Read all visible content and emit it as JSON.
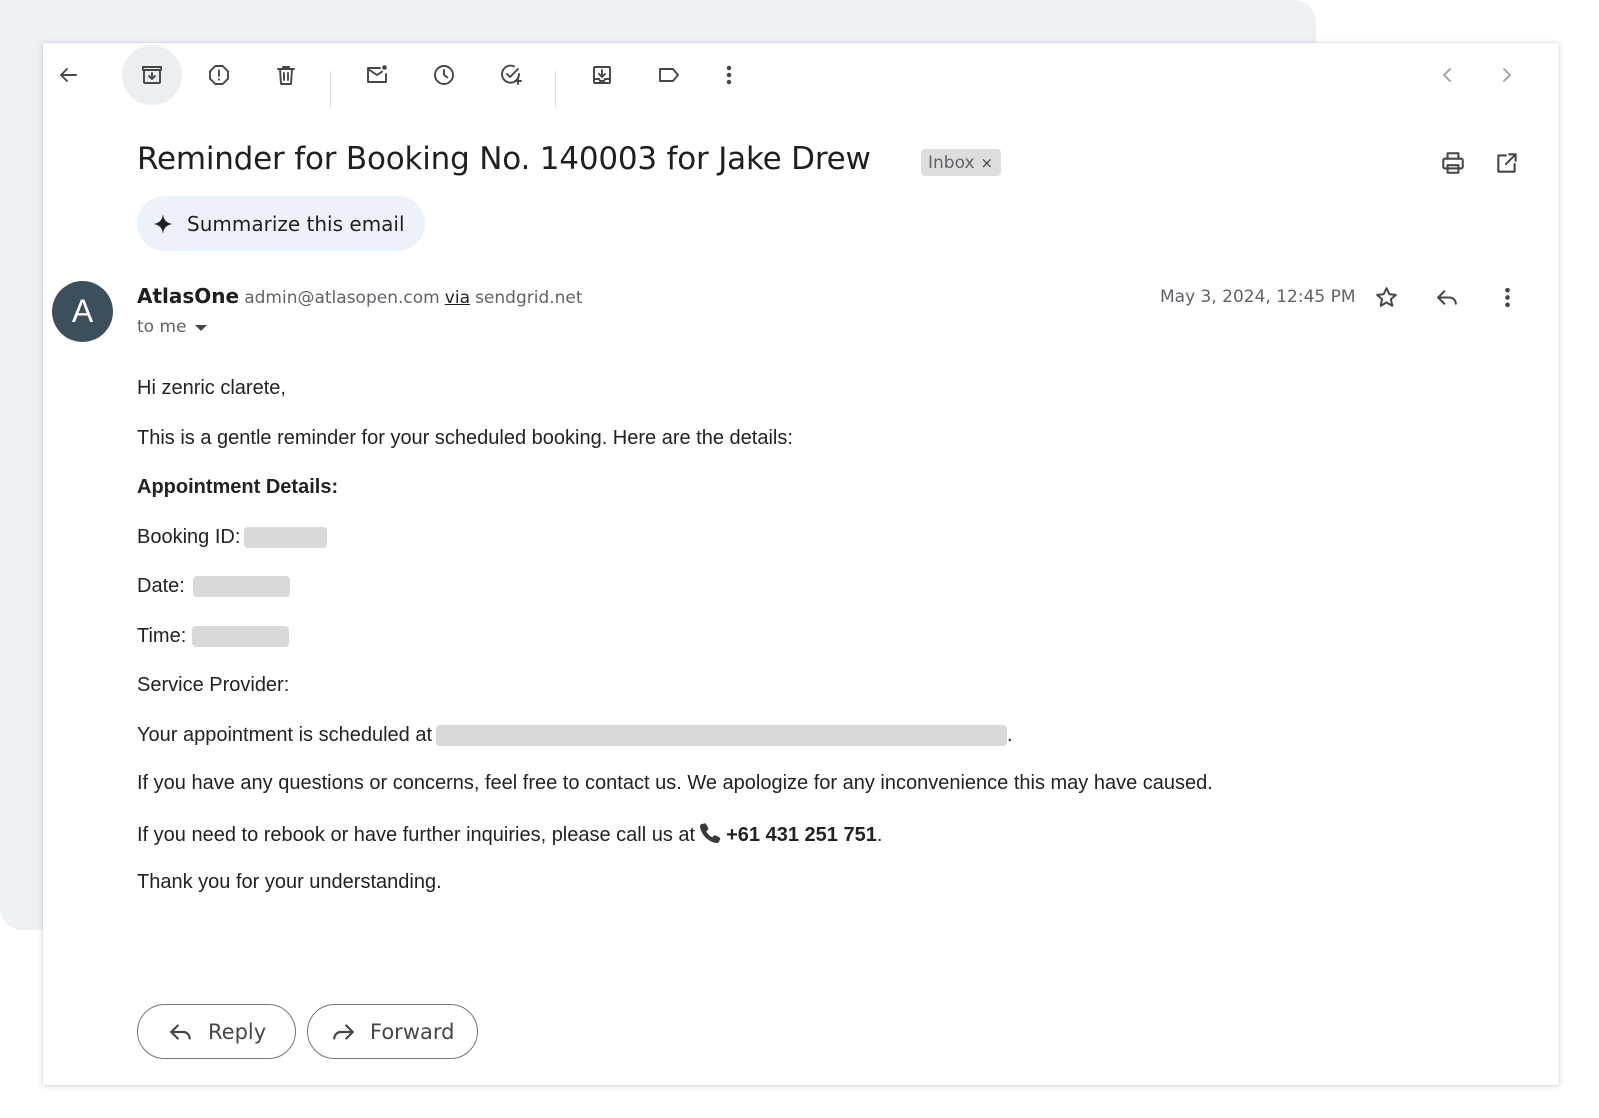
{
  "toolbar": {
    "back": "back-arrow-icon",
    "archive": "archive-icon",
    "report_spam": "report-spam-icon",
    "delete": "trash-icon",
    "mark_unread": "mark-unread-icon",
    "snooze": "clock-icon",
    "add_to_tasks": "add-task-icon",
    "move_to": "move-to-icon",
    "labels": "label-icon",
    "more": "more-vert-icon",
    "newer": "chevron-left-icon",
    "older": "chevron-right-icon"
  },
  "email": {
    "subject": "Reminder for Booking No. 140003 for Jake Drew",
    "label": "Inbox",
    "label_remove": "×",
    "summarize_label": "Summarize this email",
    "sender": {
      "avatar_letter": "A",
      "avatar_color": "#3c4f5c",
      "name": "AtlasOne",
      "email": "admin@atlasopen.com",
      "via": "via",
      "domain": "sendgrid.net",
      "to": "to me"
    },
    "timestamp": "May 3, 2024, 12:45 PM",
    "body": {
      "greeting": "Hi zenric clarete,",
      "intro": "This is a gentle reminder for your scheduled booking. Here are the details:",
      "section_title": "Appointment Details:",
      "booking_id_label": "Booking ID:",
      "date_label": "Date:",
      "time_label": "Time:",
      "provider_label": "Service Provider:",
      "location_prefix": "Your appointment is scheduled at",
      "location_suffix": ".",
      "questions": "If you have any questions or concerns, feel free to contact us. We apologize for any inconvenience this may have caused.",
      "rebook_prefix": "If you need to rebook or have further inquiries, please call us at",
      "phone": "+61 431 251 751",
      "rebook_suffix": ".",
      "closing": "Thank you for your understanding."
    }
  },
  "actions": {
    "reply": "Reply",
    "forward": "Forward"
  }
}
